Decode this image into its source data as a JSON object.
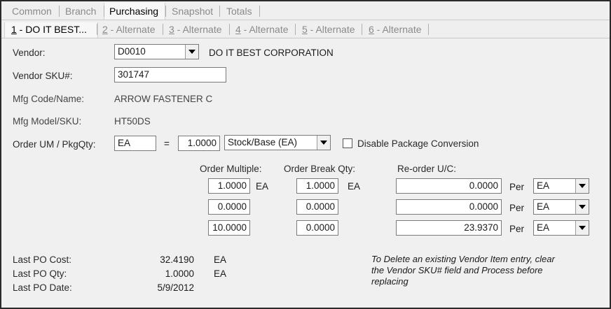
{
  "main_tabs": [
    {
      "label": "Common"
    },
    {
      "label": "Branch"
    },
    {
      "label": "Purchasing"
    },
    {
      "label": "Snapshot"
    },
    {
      "label": "Totals"
    }
  ],
  "sub_tabs": [
    {
      "key": "1",
      "label": " - DO IT BEST..."
    },
    {
      "key": "2",
      "label": " - Alternate"
    },
    {
      "key": "3",
      "label": " - Alternate"
    },
    {
      "key": "4",
      "label": " - Alternate"
    },
    {
      "key": "5",
      "label": " - Alternate"
    },
    {
      "key": "6",
      "label": " - Alternate"
    }
  ],
  "vendor": {
    "label": "Vendor:",
    "code": "D0010",
    "name": "DO IT BEST CORPORATION"
  },
  "vendor_sku": {
    "label": "Vendor SKU#:",
    "value": "301747"
  },
  "mfg_code": {
    "label": "Mfg Code/Name:",
    "value": "ARROW FASTENER C"
  },
  "mfg_model": {
    "label": "Mfg Model/SKU:",
    "value": "HT50DS"
  },
  "order_um": {
    "label": "Order UM / PkgQty:",
    "um": "EA",
    "equals": "=",
    "qty": "1.0000",
    "stock_base": "Stock/Base (EA)"
  },
  "disable_pkg": {
    "label": "Disable Package Conversion",
    "checked": false
  },
  "grid": {
    "order_multiple_header": "Order Multiple:",
    "order_break_header": "Order Break Qty:",
    "reorder_header": "Re-order U/C:",
    "per_label": "Per",
    "rows": [
      {
        "multiple": "1.0000",
        "multiple_um": "EA",
        "break_qty": "1.0000",
        "break_um": "EA",
        "reorder": "0.0000",
        "per_um": "EA"
      },
      {
        "multiple": "0.0000",
        "multiple_um": "",
        "break_qty": "0.0000",
        "break_um": "",
        "reorder": "0.0000",
        "per_um": "EA"
      },
      {
        "multiple": "10.0000",
        "multiple_um": "",
        "break_qty": "0.0000",
        "break_um": "",
        "reorder": "23.9370",
        "per_um": "EA"
      }
    ]
  },
  "last_po": {
    "cost_label": "Last PO Cost:",
    "cost": "32.4190",
    "cost_um": "EA",
    "qty_label": "Last PO  Qty:",
    "qty": "1.0000",
    "qty_um": "EA",
    "date_label": "Last PO Date:",
    "date": "5/9/2012"
  },
  "note": {
    "line1": "To Delete an existing Vendor Item entry, clear",
    "line2": "the Vendor SKU# field and Process before",
    "line3": "replacing"
  }
}
